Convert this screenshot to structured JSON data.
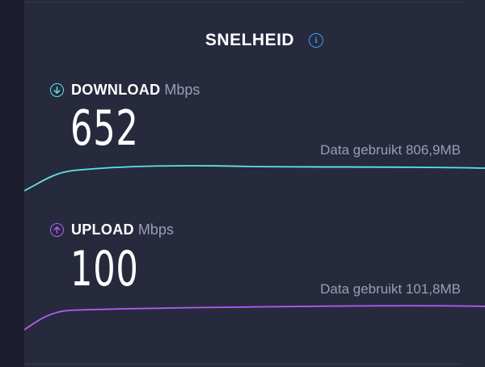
{
  "header": {
    "title": "SNELHEID",
    "info_icon": "info-icon"
  },
  "download": {
    "label": "DOWNLOAD",
    "unit": "Mbps",
    "value": "652",
    "data_used": "Data gebruikt 806,9MB",
    "color": "#5fe3e6",
    "icon": "arrow-down-circle-icon"
  },
  "upload": {
    "label": "UPLOAD",
    "unit": "Mbps",
    "value": "100",
    "data_used": "Data gebruikt 101,8MB",
    "color": "#b060f0",
    "icon": "arrow-up-circle-icon"
  }
}
